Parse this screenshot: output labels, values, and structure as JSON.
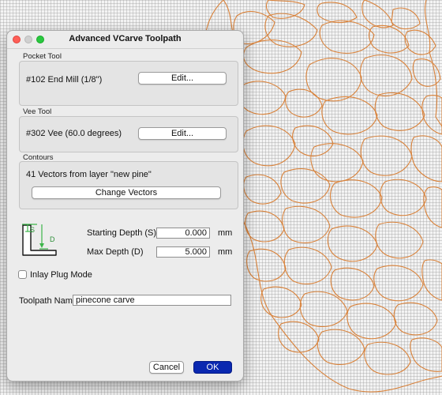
{
  "window": {
    "title": "Advanced VCarve Toolpath"
  },
  "pocket_tool": {
    "label": "Pocket Tool",
    "tool": "#102 End Mill (1/8\")",
    "edit_label": "Edit..."
  },
  "vee_tool": {
    "label": "Vee Tool",
    "tool": "#302 Vee (60.0 degrees)",
    "edit_label": "Edit..."
  },
  "contours": {
    "label": "Contours",
    "vectors_text": "41 Vectors from layer \"new pine\"",
    "change_label": "Change Vectors"
  },
  "depth": {
    "diagram_s": "S",
    "diagram_d": "D",
    "starting_label": "Starting Depth (S)",
    "starting_value": "0.000",
    "starting_unit": "mm",
    "max_label": "Max Depth (D)",
    "max_value": "5.000",
    "max_unit": "mm"
  },
  "inlay": {
    "label": "Inlay Plug Mode",
    "checked": false
  },
  "toolpath_name": {
    "label": "Toolpath Name",
    "value": "pinecone carve"
  },
  "buttons": {
    "cancel": "Cancel",
    "ok": "OK"
  },
  "colors": {
    "accent": "#0a28b0",
    "contour": "#d9823a",
    "diagram_green": "#3cb54a"
  }
}
